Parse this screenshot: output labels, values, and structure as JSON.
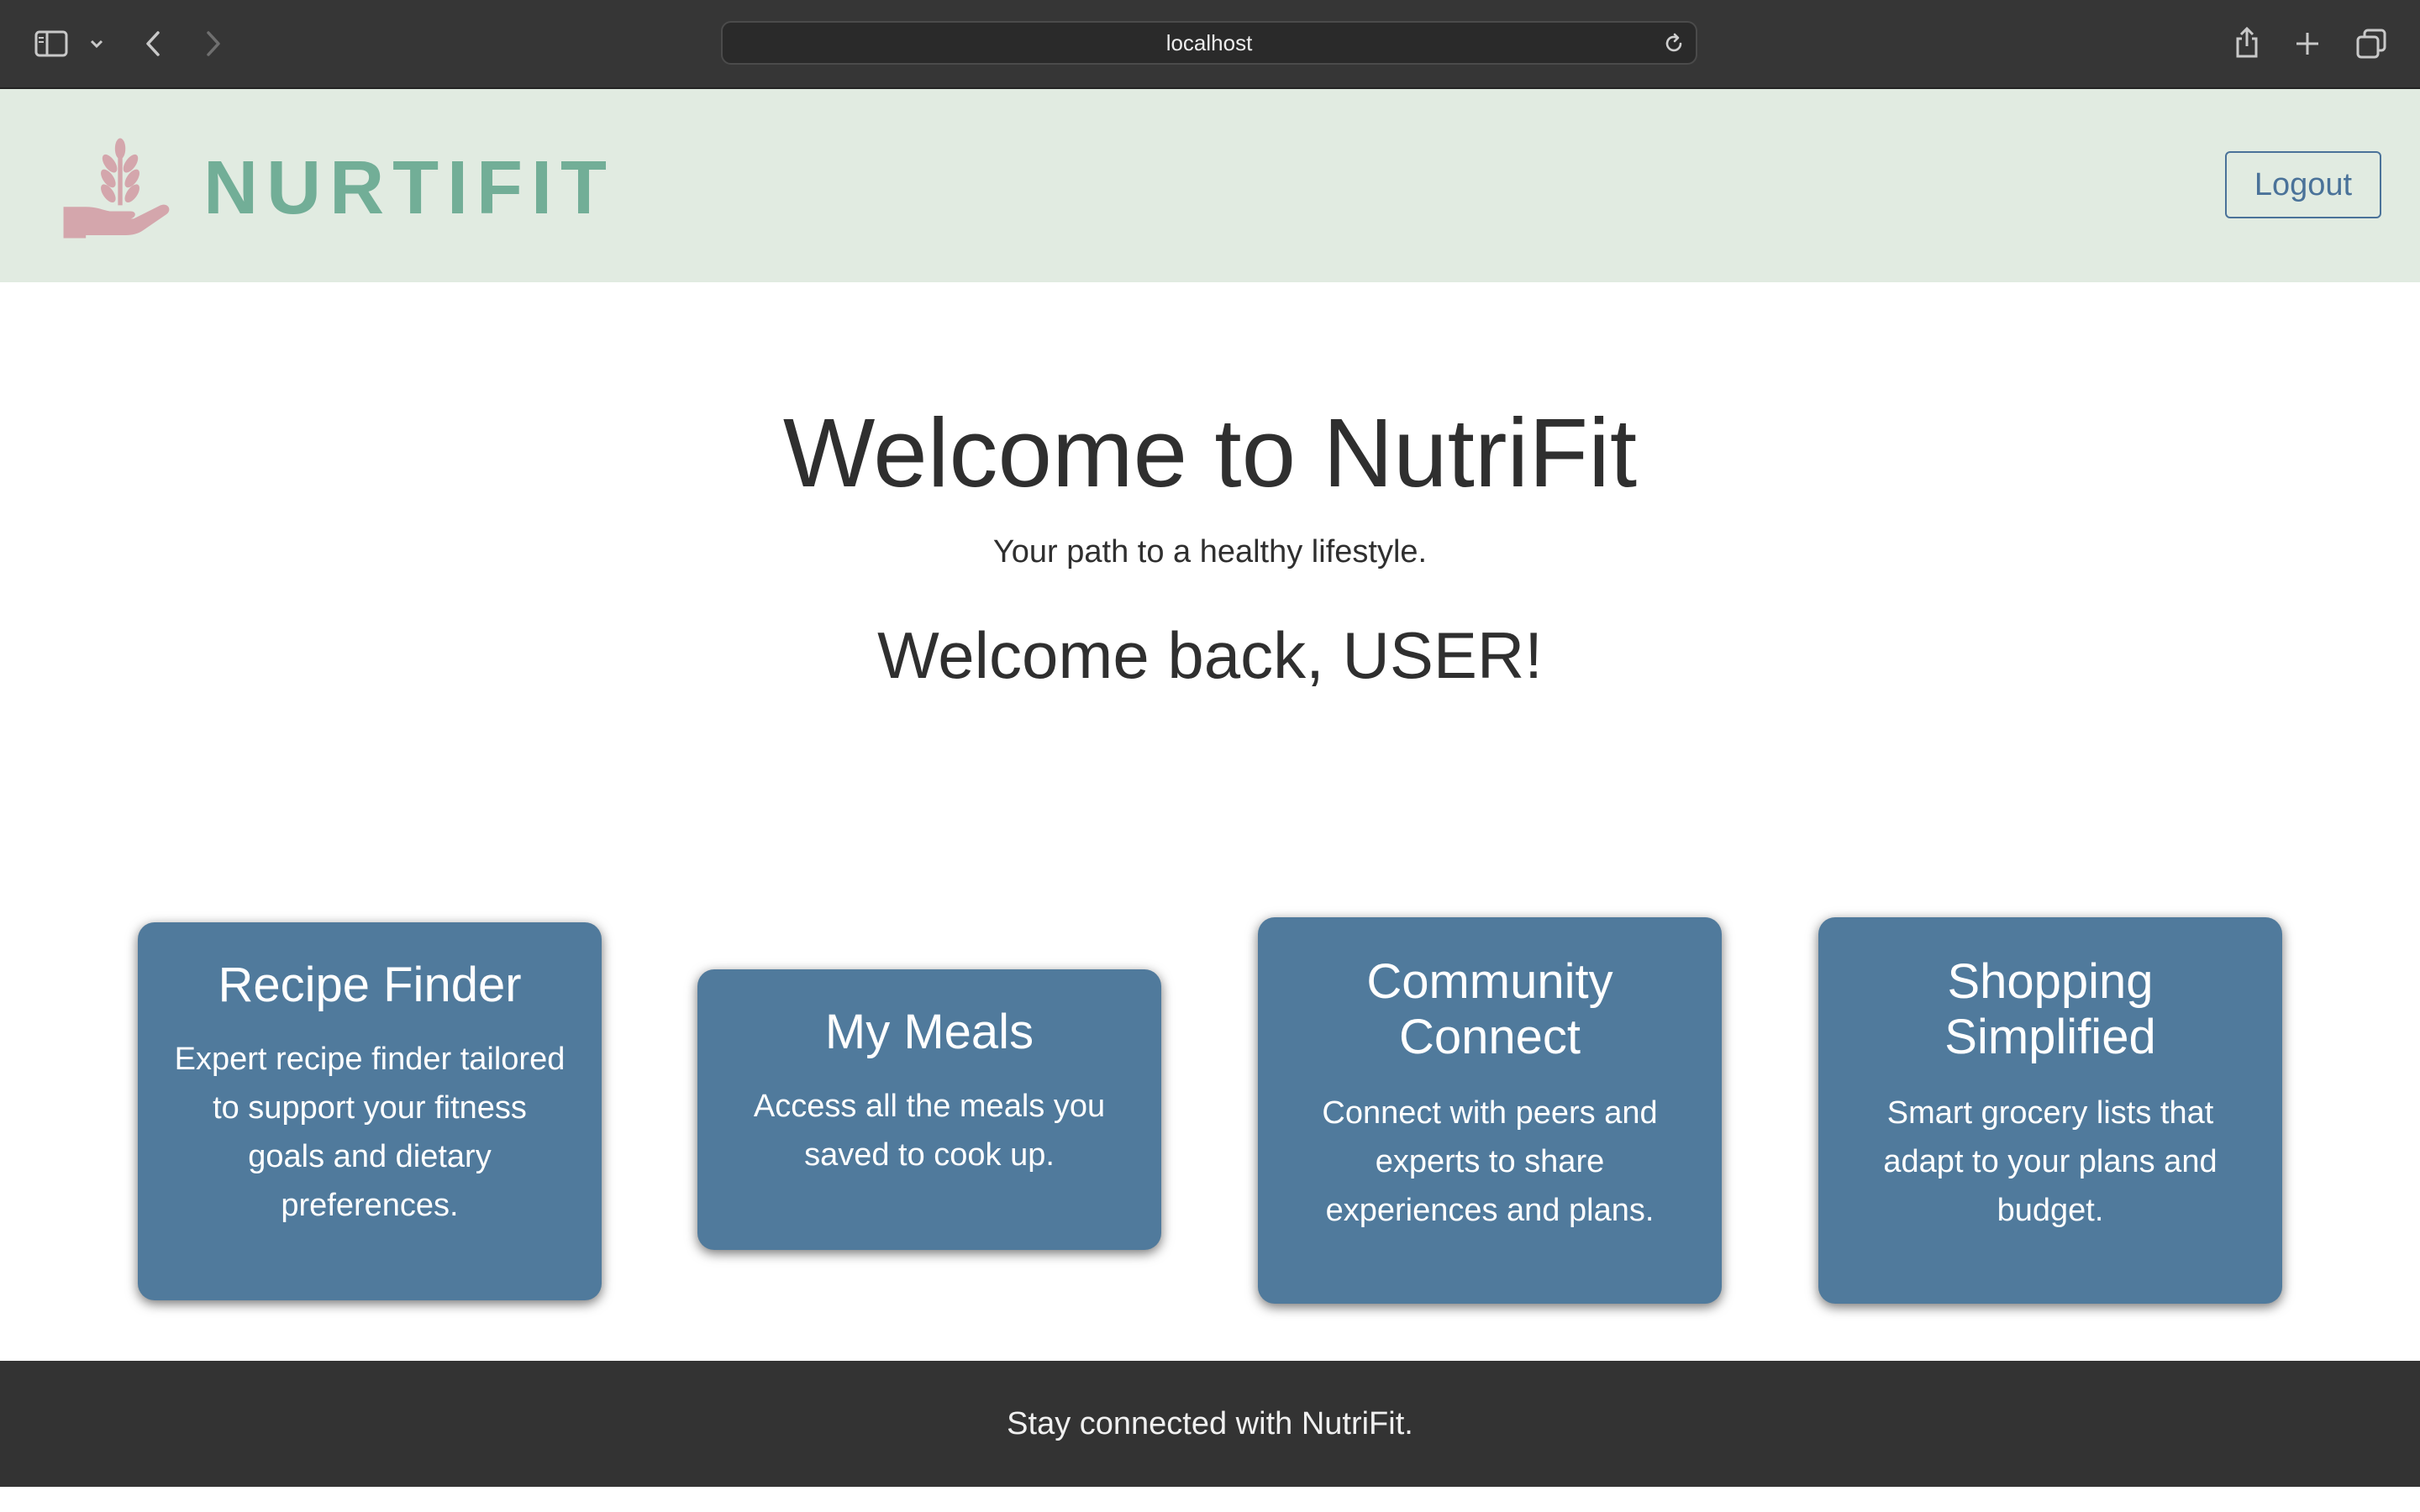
{
  "browser": {
    "address": "localhost",
    "icons": [
      "sidebar-icon",
      "chevron-down-icon",
      "back-arrow-icon",
      "forward-arrow-icon",
      "reload-icon",
      "share-icon",
      "new-tab-icon",
      "tab-overview-icon"
    ]
  },
  "header": {
    "logo_text": "NURTIFIT",
    "logout_label": "Logout",
    "colors": {
      "header_bg": "#e1ebe1",
      "logo_green": "#72ae97",
      "logo_pink": "#d4a6ac",
      "logout_blue": "#4a7299"
    }
  },
  "hero": {
    "title": "Welcome to NutriFit",
    "subtitle": "Your path to a healthy lifestyle.",
    "welcome_back": "Welcome back, USER!"
  },
  "cards": [
    {
      "title": "Recipe Finder",
      "description": "Expert recipe finder tailored to support your fitness goals and dietary preferences."
    },
    {
      "title": "My Meals",
      "description": "Access all the meals you saved to cook up."
    },
    {
      "title": "Community Connect",
      "description": "Connect with peers and experts to share experiences and plans."
    },
    {
      "title": "Shopping Simplified",
      "description": "Smart grocery lists that adapt to your plans and budget."
    }
  ],
  "card_color": "#507a9c",
  "footer": {
    "text": "Stay connected with NutriFit."
  }
}
